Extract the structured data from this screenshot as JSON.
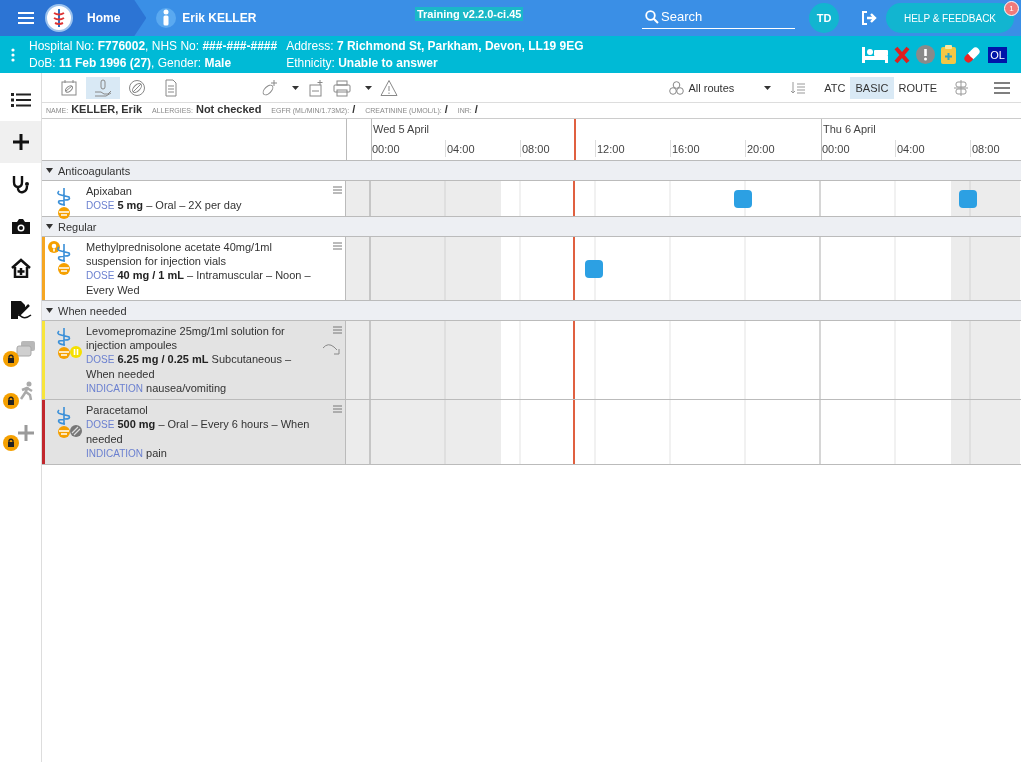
{
  "top_bar": {
    "home": "Home",
    "patient": "Erik KELLER",
    "version": "Training v2.2.0-ci.45",
    "search": {
      "placeholder": "Search"
    },
    "user_initials": "TD",
    "help_button": "HELP & FEEDBACK",
    "help_badge": "1"
  },
  "banner": {
    "columns": [
      [
        "Hospital No: **F776002**, NHS No: **###-###-####**",
        "DoB: **11 Feb 1996 (27)**, Gender: **Male**"
      ],
      [
        "Address: **7 Richmond St, Parkham, Devon, LL19 9EG**",
        "Ethnicity: **Unable to answer**"
      ]
    ],
    "alerts": [
      {
        "kind": "bed"
      },
      {
        "kind": "cross"
      },
      {
        "kind": "exclamation"
      },
      {
        "kind": "clipboard"
      },
      {
        "kind": "pill"
      },
      {
        "kind": "label",
        "text": "OL"
      }
    ]
  },
  "sidebar": [
    {
      "kind": "list",
      "selected": false,
      "locked": false
    },
    {
      "kind": "add",
      "selected": true,
      "locked": false
    },
    {
      "kind": "stethoscope",
      "selected": false,
      "locked": false
    },
    {
      "kind": "camera",
      "selected": false,
      "locked": false
    },
    {
      "kind": "home",
      "selected": false,
      "locked": false
    },
    {
      "kind": "sign",
      "selected": false,
      "locked": false
    },
    {
      "kind": "messages",
      "selected": false,
      "locked": true
    },
    {
      "kind": "walk",
      "selected": false,
      "locked": true
    },
    {
      "kind": "add",
      "selected": false,
      "locked": true
    }
  ],
  "toolbar": {
    "tools": [
      {
        "kind": "calendar",
        "selected": false,
        "dropdown": false
      },
      {
        "kind": "hand",
        "selected": true,
        "dropdown": false
      },
      {
        "kind": "pill",
        "selected": false,
        "dropdown": false
      },
      {
        "kind": "document",
        "selected": false,
        "dropdown": false
      },
      {
        "kind": "add-pill",
        "selected": false,
        "dropdown": true
      },
      {
        "kind": "add-ref",
        "selected": false,
        "dropdown": false
      },
      {
        "kind": "print",
        "selected": false,
        "dropdown": true
      },
      {
        "kind": "warning",
        "selected": false,
        "dropdown": false
      }
    ],
    "routes": "All routes",
    "views": [
      {
        "label": "ATC",
        "selected": false
      },
      {
        "label": "BASIC",
        "selected": true
      },
      {
        "label": "ROUTE",
        "selected": false
      }
    ]
  },
  "info": [
    {
      "label": "NAME:",
      "value": "KELLER, Erik"
    },
    {
      "label": "ALLERGIES:",
      "value": "Not checked"
    },
    {
      "label": "EGFR (ML/MIN/1.73M2):",
      "value": "/"
    },
    {
      "label": "CREATININE (UMOL/L):",
      "value": "/"
    },
    {
      "label": "INR:",
      "value": "/"
    }
  ],
  "timeline": {
    "days": [
      {
        "label": "Wed 5 April",
        "hours": [
          "00:00",
          "04:00",
          "08:00",
          "12:00",
          "16:00",
          "20:00"
        ]
      },
      {
        "label": "Thu 6 April",
        "hours": [
          "00:00",
          "04:00",
          "08:00"
        ]
      }
    ],
    "now": {
      "level": 0.337
    }
  },
  "groups": [
    {
      "name": "Anticoagulants",
      "expanded": true,
      "meds": [
        {
          "name": "Apixaban",
          "kind": "plain",
          "greyed": false,
          "warning": false,
          "switch": false,
          "dose_label": "DOSE",
          "dose": "**5 mg** – Oral – 2X per day",
          "doses": [
            {
              "level": 0.589
            },
            {
              "level": 0.923
            }
          ]
        }
      ]
    },
    {
      "name": "Regular",
      "expanded": true,
      "meds": [
        {
          "name": "Methylprednisolone acetate 40mg/1ml suspension for injection vials",
          "color": "#f5a623",
          "kind": "plain",
          "greyed": false,
          "warning": true,
          "switch": false,
          "dose_label": "DOSE",
          "dose": "**40 mg / 1 mL** – Intramuscular – Noon – Every Wed",
          "doses": [
            {
              "level": 0.368
            }
          ]
        }
      ]
    },
    {
      "name": "When needed",
      "expanded": true,
      "meds": [
        {
          "name": "Levomepromazine 25mg/1ml solution for injection ampoules",
          "color": "#f7e53b",
          "greyed": true,
          "warning": false,
          "kind": "paused",
          "switch": true,
          "dose_label": "DOSE",
          "dose": "**6.25 mg / 0.25 mL** Subcutaneous – When needed",
          "indication_label": "INDICATION",
          "indication": "nausea/vomiting"
        },
        {
          "name": "Paracetamol",
          "color": "#c1272d",
          "greyed": true,
          "warning": false,
          "kind": "striped",
          "switch": false,
          "dose_label": "DOSE",
          "dose": "**500 mg** – Oral – Every 6 hours – When needed",
          "indication_label": "INDICATION",
          "indication": "pain"
        }
      ]
    }
  ]
}
